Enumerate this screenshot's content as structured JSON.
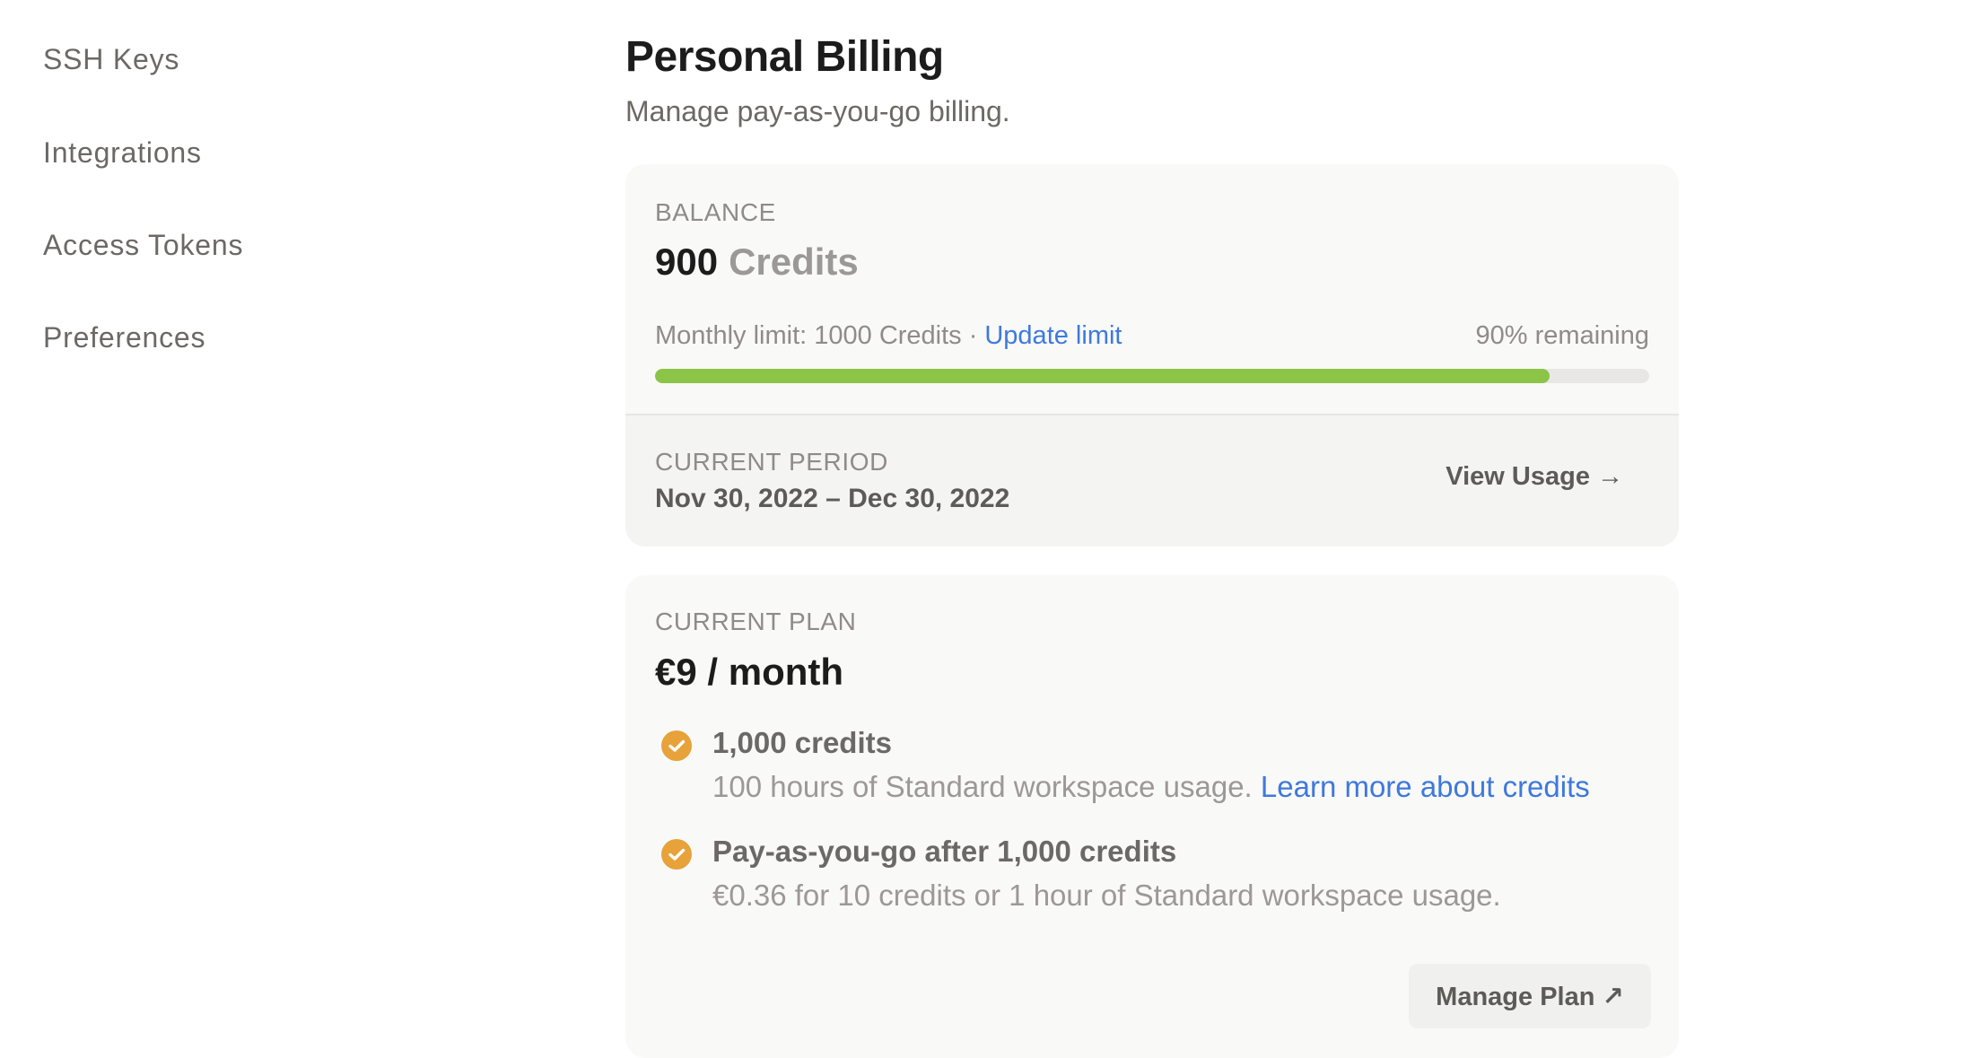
{
  "sidebar": {
    "items": [
      {
        "label": "SSH Keys"
      },
      {
        "label": "Integrations"
      },
      {
        "label": "Access Tokens"
      },
      {
        "label": "Preferences"
      }
    ]
  },
  "header": {
    "title": "Personal Billing",
    "subtitle": "Manage pay-as-you-go billing."
  },
  "balance": {
    "label": "BALANCE",
    "amount": "900",
    "unit": "Credits",
    "limit_text": "Monthly limit: 1000 Credits",
    "separator": "·",
    "update_limit_link": "Update limit",
    "remaining_text": "90% remaining",
    "remaining_fraction": 0.9,
    "progress_color": "#8cc447"
  },
  "period": {
    "label": "CURRENT PERIOD",
    "dates": "Nov 30, 2022 – Dec 30, 2022",
    "view_usage_label": "View Usage →"
  },
  "plan": {
    "label": "CURRENT PLAN",
    "price": "€9 / month",
    "features": [
      {
        "title": "1,000 credits",
        "description": "100 hours of Standard workspace usage.",
        "link": "Learn more about credits",
        "icon": "check-circle-icon"
      },
      {
        "title": "Pay-as-you-go after 1,000 credits",
        "description": "€0.36 for 10 credits or 1 hour of Standard workspace usage.",
        "icon": "check-circle-icon"
      }
    ],
    "manage_plan_label": "Manage Plan ↗"
  },
  "colors": {
    "accent_link": "#3e79dc",
    "check": "#e7a23a",
    "progress": "#8cc447"
  }
}
